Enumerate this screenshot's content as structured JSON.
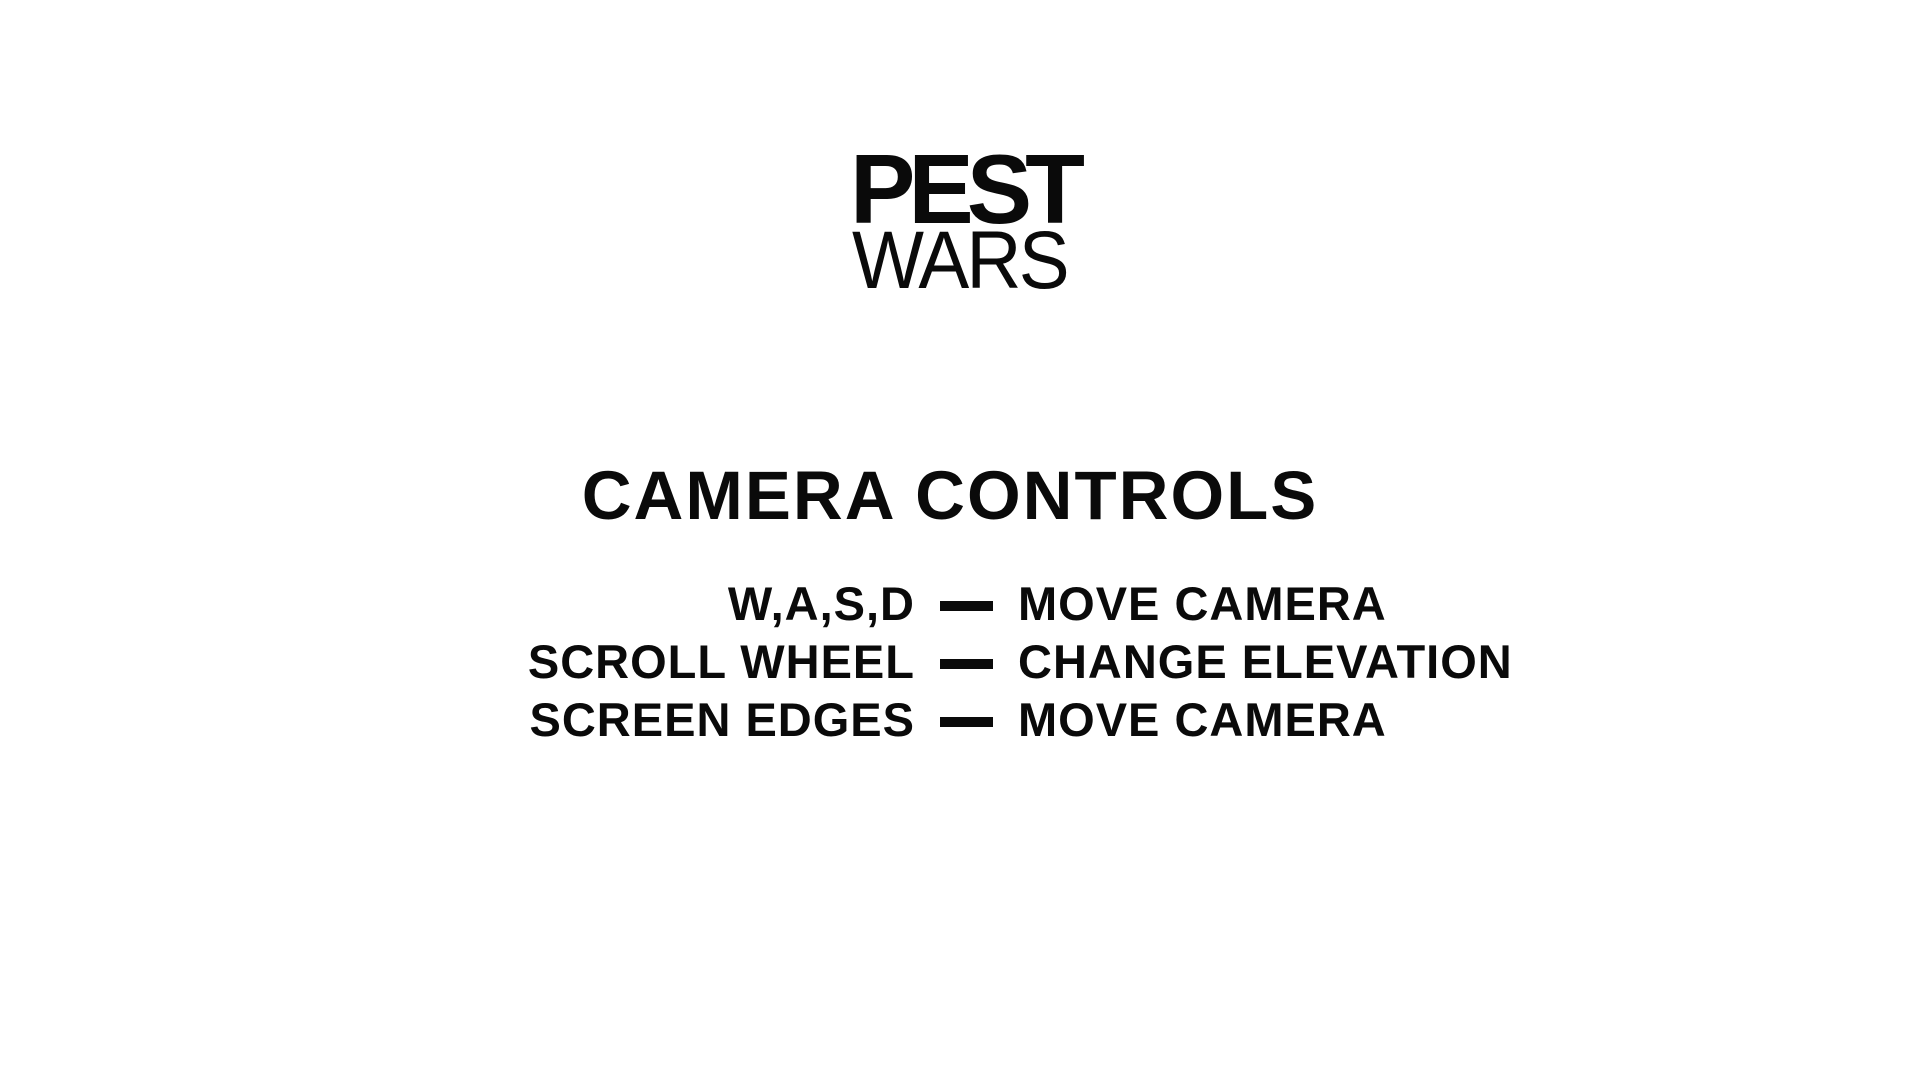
{
  "logo": {
    "line1": "PEST",
    "line2": "WARS"
  },
  "section": {
    "title": "CAMERA CONTROLS"
  },
  "controls": [
    {
      "key": "W,A,S,D",
      "action": "MOVE CAMERA"
    },
    {
      "key": "SCROLL WHEEL",
      "action": "CHANGE ELEVATION"
    },
    {
      "key": "SCREEN EDGES",
      "action": "MOVE CAMERA"
    }
  ],
  "colors": {
    "background": "#ffffff",
    "text": "#0a0a0a"
  }
}
